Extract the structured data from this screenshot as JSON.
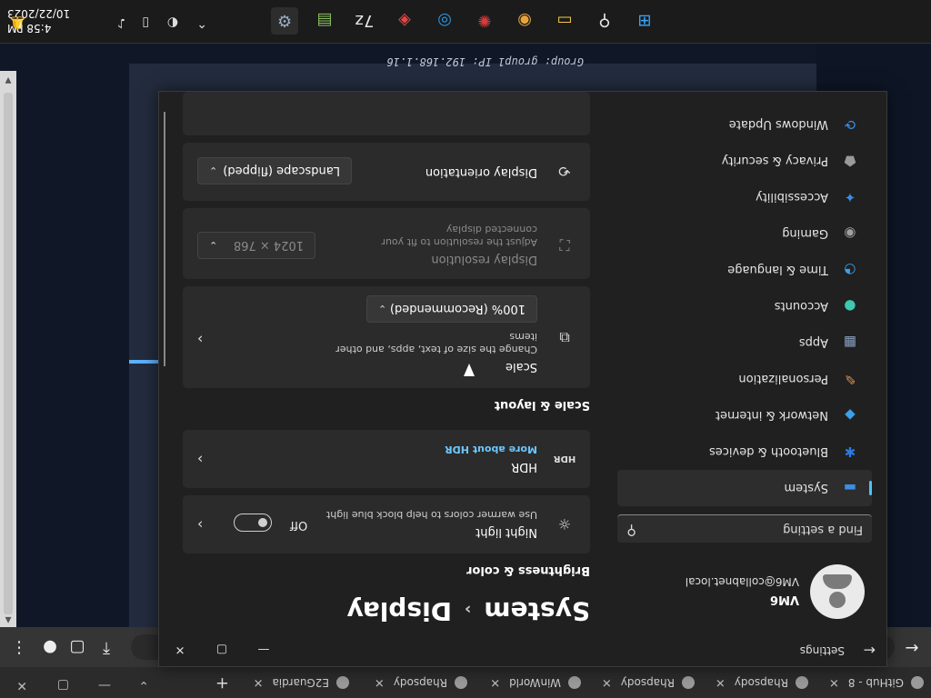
{
  "browser": {
    "tabs": [
      {
        "label": "GitHub - 8",
        "icon": "github-icon"
      },
      {
        "label": "Rhapsody",
        "icon": "rhapsody-icon"
      },
      {
        "label": "Rhapsody",
        "icon": "rhapsody-icon"
      },
      {
        "label": "WinWorld",
        "icon": "globe-icon"
      },
      {
        "label": "Rhapsody",
        "icon": "rhapsody-icon"
      },
      {
        "label": "E2Guardia",
        "icon": "globe-icon"
      }
    ],
    "new_tab": "+",
    "close": "✕"
  },
  "settings": {
    "app_title": "Settings",
    "profile": {
      "name": "VM6",
      "email": "VM6@collabnet.local"
    },
    "search_placeholder": "Find a setting",
    "nav": [
      {
        "label": "System",
        "icon": "monitor-icon",
        "color": "#3a8ee6"
      },
      {
        "label": "Bluetooth & devices",
        "icon": "bluetooth-icon",
        "color": "#2b7be4"
      },
      {
        "label": "Network & internet",
        "icon": "wifi-icon",
        "color": "#3aa0e8"
      },
      {
        "label": "Personalization",
        "icon": "brush-icon",
        "color": "#e0904a"
      },
      {
        "label": "Apps",
        "icon": "apps-icon",
        "color": "#8aa0c0"
      },
      {
        "label": "Accounts",
        "icon": "person-icon",
        "color": "#3cc9b0"
      },
      {
        "label": "Time & language",
        "icon": "globe-clock-icon",
        "color": "#3aa0e8"
      },
      {
        "label": "Gaming",
        "icon": "gamepad-icon",
        "color": "#a0a0a0"
      },
      {
        "label": "Accessibility",
        "icon": "accessibility-icon",
        "color": "#3a8ee6"
      },
      {
        "label": "Privacy & security",
        "icon": "shield-icon",
        "color": "#9a9a9a"
      },
      {
        "label": "Windows Update",
        "icon": "update-icon",
        "color": "#3a8ee6"
      }
    ],
    "breadcrumb": {
      "parent": "System",
      "separator": "›",
      "current": "Display"
    },
    "sections": {
      "brightness": "Brightness & color",
      "scale_layout": "Scale & layout"
    },
    "night_light": {
      "title": "Night light",
      "subtitle": "Use warmer colors to help block blue light",
      "state": "Off",
      "on": false
    },
    "hdr": {
      "title": "HDR",
      "link": "More about HDR"
    },
    "scale": {
      "title": "Scale",
      "subtitle": "Change the size of text, apps, and other items",
      "value": "100% (Recommended)"
    },
    "resolution": {
      "title": "Display resolution",
      "subtitle": "Adjust the resolution to fit your connected display",
      "value": "1024 × 768"
    },
    "orientation": {
      "title": "Display orientation",
      "value": "Landscape (flipped)"
    }
  },
  "remote": {
    "bginfo": "Group: group1    IP: 192.168.1.16"
  },
  "taskbar": {
    "apps": [
      {
        "icon": "start-icon",
        "color": "#3aa8ff"
      },
      {
        "icon": "search-icon",
        "color": "#e8e8e8"
      },
      {
        "icon": "file-explorer-icon",
        "color": "#f2c94c"
      },
      {
        "icon": "chrome-icon",
        "color": "#e8a33c"
      },
      {
        "icon": "app-red-icon",
        "color": "#d83b3b"
      },
      {
        "icon": "app-ring-icon",
        "color": "#2b9be8"
      },
      {
        "icon": "anydesk-icon",
        "color": "#e04848"
      },
      {
        "icon": "7zip-icon",
        "color": "#e8e8e8"
      },
      {
        "icon": "app-grid-icon",
        "color": "#8ac060"
      },
      {
        "icon": "settings-gear-icon",
        "color": "#9ab0c8"
      }
    ],
    "clock": {
      "time": "4:58 PM",
      "date": "10/22/2023"
    }
  }
}
